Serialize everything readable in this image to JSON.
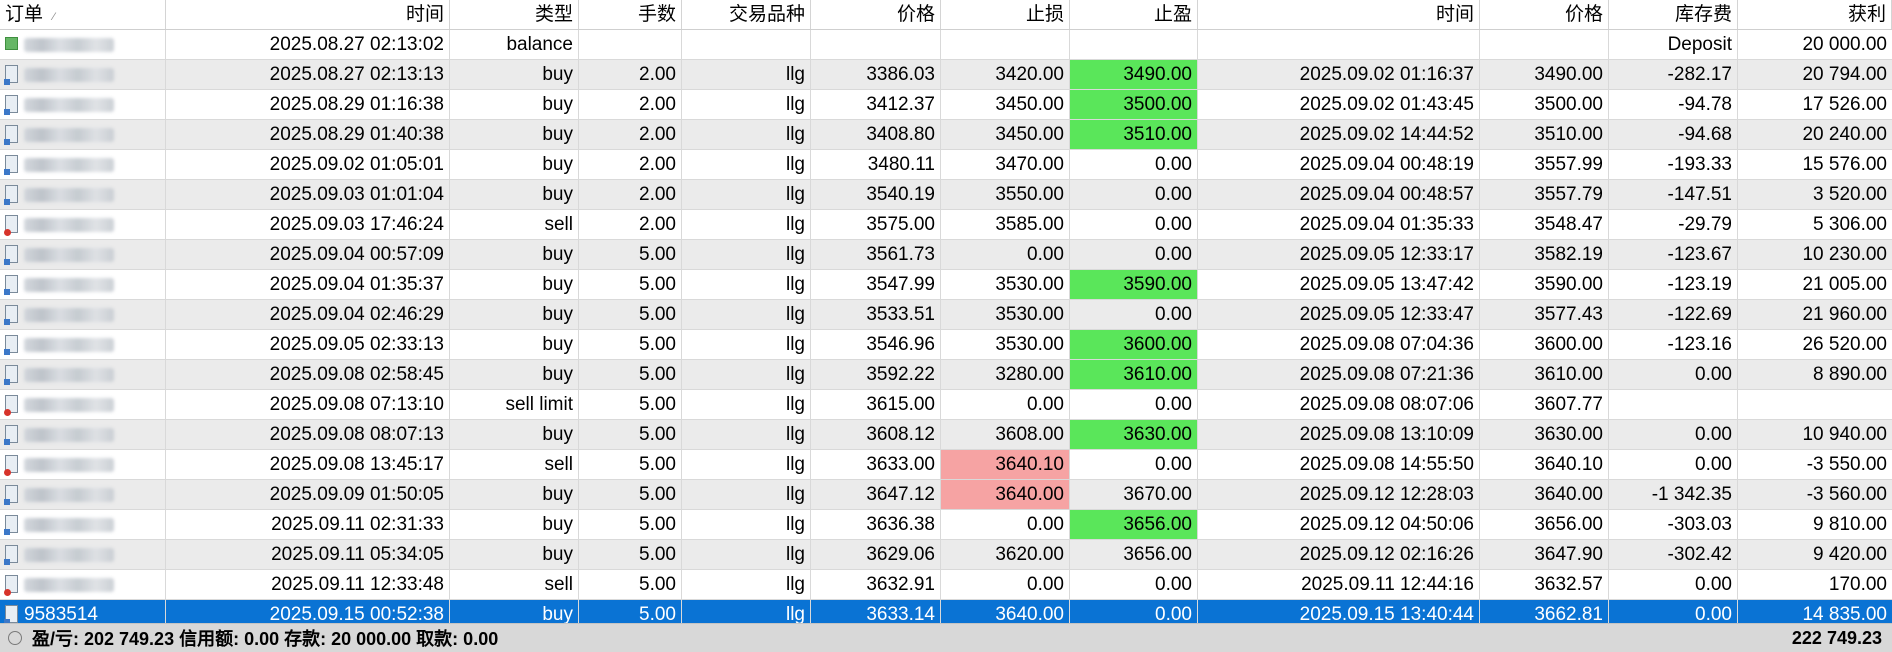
{
  "headers": [
    "订单",
    "时间",
    "类型",
    "手数",
    "交易品种",
    "价格",
    "止损",
    "止盈",
    "时间",
    "价格",
    "库存费",
    "获利"
  ],
  "rows": [
    {
      "order": "",
      "icon": "balance",
      "open_time": "2025.08.27 02:13:02",
      "type": "balance",
      "lots": "",
      "symbol": "",
      "price": "",
      "sl": "",
      "tp": "",
      "close_time": "",
      "close_price": "",
      "swap": "Deposit",
      "profit": "20 000.00",
      "sl_hl": "",
      "tp_hl": ""
    },
    {
      "order": "",
      "icon": "buy",
      "open_time": "2025.08.27 02:13:13",
      "type": "buy",
      "lots": "2.00",
      "symbol": "llg",
      "price": "3386.03",
      "sl": "3420.00",
      "tp": "3490.00",
      "close_time": "2025.09.02 01:16:37",
      "close_price": "3490.00",
      "swap": "-282.17",
      "profit": "20 794.00",
      "sl_hl": "",
      "tp_hl": "green"
    },
    {
      "order": "",
      "icon": "buy",
      "open_time": "2025.08.29 01:16:38",
      "type": "buy",
      "lots": "2.00",
      "symbol": "llg",
      "price": "3412.37",
      "sl": "3450.00",
      "tp": "3500.00",
      "close_time": "2025.09.02 01:43:45",
      "close_price": "3500.00",
      "swap": "-94.78",
      "profit": "17 526.00",
      "sl_hl": "",
      "tp_hl": "green"
    },
    {
      "order": "",
      "icon": "buy",
      "open_time": "2025.08.29 01:40:38",
      "type": "buy",
      "lots": "2.00",
      "symbol": "llg",
      "price": "3408.80",
      "sl": "3450.00",
      "tp": "3510.00",
      "close_time": "2025.09.02 14:44:52",
      "close_price": "3510.00",
      "swap": "-94.68",
      "profit": "20 240.00",
      "sl_hl": "",
      "tp_hl": "green"
    },
    {
      "order": "",
      "icon": "buy",
      "open_time": "2025.09.02 01:05:01",
      "type": "buy",
      "lots": "2.00",
      "symbol": "llg",
      "price": "3480.11",
      "sl": "3470.00",
      "tp": "0.00",
      "close_time": "2025.09.04 00:48:19",
      "close_price": "3557.99",
      "swap": "-193.33",
      "profit": "15 576.00",
      "sl_hl": "",
      "tp_hl": ""
    },
    {
      "order": "",
      "icon": "buy",
      "open_time": "2025.09.03 01:01:04",
      "type": "buy",
      "lots": "2.00",
      "symbol": "llg",
      "price": "3540.19",
      "sl": "3550.00",
      "tp": "0.00",
      "close_time": "2025.09.04 00:48:57",
      "close_price": "3557.79",
      "swap": "-147.51",
      "profit": "3 520.00",
      "sl_hl": "",
      "tp_hl": ""
    },
    {
      "order": "",
      "icon": "sell",
      "open_time": "2025.09.03 17:46:24",
      "type": "sell",
      "lots": "2.00",
      "symbol": "llg",
      "price": "3575.00",
      "sl": "3585.00",
      "tp": "0.00",
      "close_time": "2025.09.04 01:35:33",
      "close_price": "3548.47",
      "swap": "-29.79",
      "profit": "5 306.00",
      "sl_hl": "",
      "tp_hl": ""
    },
    {
      "order": "",
      "icon": "buy",
      "open_time": "2025.09.04 00:57:09",
      "type": "buy",
      "lots": "5.00",
      "symbol": "llg",
      "price": "3561.73",
      "sl": "0.00",
      "tp": "0.00",
      "close_time": "2025.09.05 12:33:17",
      "close_price": "3582.19",
      "swap": "-123.67",
      "profit": "10 230.00",
      "sl_hl": "",
      "tp_hl": ""
    },
    {
      "order": "",
      "icon": "buy",
      "open_time": "2025.09.04 01:35:37",
      "type": "buy",
      "lots": "5.00",
      "symbol": "llg",
      "price": "3547.99",
      "sl": "3530.00",
      "tp": "3590.00",
      "close_time": "2025.09.05 13:47:42",
      "close_price": "3590.00",
      "swap": "-123.19",
      "profit": "21 005.00",
      "sl_hl": "",
      "tp_hl": "green"
    },
    {
      "order": "",
      "icon": "buy",
      "open_time": "2025.09.04 02:46:29",
      "type": "buy",
      "lots": "5.00",
      "symbol": "llg",
      "price": "3533.51",
      "sl": "3530.00",
      "tp": "0.00",
      "close_time": "2025.09.05 12:33:47",
      "close_price": "3577.43",
      "swap": "-122.69",
      "profit": "21 960.00",
      "sl_hl": "",
      "tp_hl": ""
    },
    {
      "order": "",
      "icon": "buy",
      "open_time": "2025.09.05 02:33:13",
      "type": "buy",
      "lots": "5.00",
      "symbol": "llg",
      "price": "3546.96",
      "sl": "3530.00",
      "tp": "3600.00",
      "close_time": "2025.09.08 07:04:36",
      "close_price": "3600.00",
      "swap": "-123.16",
      "profit": "26 520.00",
      "sl_hl": "",
      "tp_hl": "green"
    },
    {
      "order": "",
      "icon": "buy",
      "open_time": "2025.09.08 02:58:45",
      "type": "buy",
      "lots": "5.00",
      "symbol": "llg",
      "price": "3592.22",
      "sl": "3280.00",
      "tp": "3610.00",
      "close_time": "2025.09.08 07:21:36",
      "close_price": "3610.00",
      "swap": "0.00",
      "profit": "8 890.00",
      "sl_hl": "",
      "tp_hl": "green"
    },
    {
      "order": "",
      "icon": "sell",
      "open_time": "2025.09.08 07:13:10",
      "type": "sell limit",
      "lots": "5.00",
      "symbol": "llg",
      "price": "3615.00",
      "sl": "0.00",
      "tp": "0.00",
      "close_time": "2025.09.08 08:07:06",
      "close_price": "3607.77",
      "swap": "",
      "profit": "",
      "sl_hl": "",
      "tp_hl": ""
    },
    {
      "order": "",
      "icon": "buy",
      "open_time": "2025.09.08 08:07:13",
      "type": "buy",
      "lots": "5.00",
      "symbol": "llg",
      "price": "3608.12",
      "sl": "3608.00",
      "tp": "3630.00",
      "close_time": "2025.09.08 13:10:09",
      "close_price": "3630.00",
      "swap": "0.00",
      "profit": "10 940.00",
      "sl_hl": "",
      "tp_hl": "green"
    },
    {
      "order": "",
      "icon": "sell",
      "open_time": "2025.09.08 13:45:17",
      "type": "sell",
      "lots": "5.00",
      "symbol": "llg",
      "price": "3633.00",
      "sl": "3640.10",
      "tp": "0.00",
      "close_time": "2025.09.08 14:55:50",
      "close_price": "3640.10",
      "swap": "0.00",
      "profit": "-3 550.00",
      "sl_hl": "red",
      "tp_hl": ""
    },
    {
      "order": "",
      "icon": "buy",
      "open_time": "2025.09.09 01:50:05",
      "type": "buy",
      "lots": "5.00",
      "symbol": "llg",
      "price": "3647.12",
      "sl": "3640.00",
      "tp": "3670.00",
      "close_time": "2025.09.12 12:28:03",
      "close_price": "3640.00",
      "swap": "-1 342.35",
      "profit": "-3 560.00",
      "sl_hl": "red",
      "tp_hl": ""
    },
    {
      "order": "",
      "icon": "buy",
      "open_time": "2025.09.11 02:31:33",
      "type": "buy",
      "lots": "5.00",
      "symbol": "llg",
      "price": "3636.38",
      "sl": "0.00",
      "tp": "3656.00",
      "close_time": "2025.09.12 04:50:06",
      "close_price": "3656.00",
      "swap": "-303.03",
      "profit": "9 810.00",
      "sl_hl": "",
      "tp_hl": "green"
    },
    {
      "order": "",
      "icon": "buy",
      "open_time": "2025.09.11 05:34:05",
      "type": "buy",
      "lots": "5.00",
      "symbol": "llg",
      "price": "3629.06",
      "sl": "3620.00",
      "tp": "3656.00",
      "close_time": "2025.09.12 02:16:26",
      "close_price": "3647.90",
      "swap": "-302.42",
      "profit": "9 420.00",
      "sl_hl": "",
      "tp_hl": ""
    },
    {
      "order": "",
      "icon": "sell",
      "open_time": "2025.09.11 12:33:48",
      "type": "sell",
      "lots": "5.00",
      "symbol": "llg",
      "price": "3632.91",
      "sl": "0.00",
      "tp": "0.00",
      "close_time": "2025.09.11 12:44:16",
      "close_price": "3632.57",
      "swap": "0.00",
      "profit": "170.00",
      "sl_hl": "",
      "tp_hl": ""
    },
    {
      "order": "9583514",
      "icon": "buy",
      "open_time": "2025.09.15 00:52:38",
      "type": "buy",
      "lots": "5.00",
      "symbol": "llg",
      "price": "3633.14",
      "sl": "3640.00",
      "tp": "0.00",
      "close_time": "2025.09.15 13:40:44",
      "close_price": "3662.81",
      "swap": "0.00",
      "profit": "14 835.00",
      "sl_hl": "",
      "tp_hl": "",
      "selected": true
    }
  ],
  "footer": {
    "summary": "盈/亏: 202 749.23  信用额: 0.00  存款: 20 000.00  取款: 0.00",
    "total": "222 749.23"
  },
  "colors": {
    "tp_hit": "#5ae65a",
    "sl_hit": "#f6a3a3",
    "selection": "#0a73d4",
    "alt_row": "#ebebeb"
  }
}
